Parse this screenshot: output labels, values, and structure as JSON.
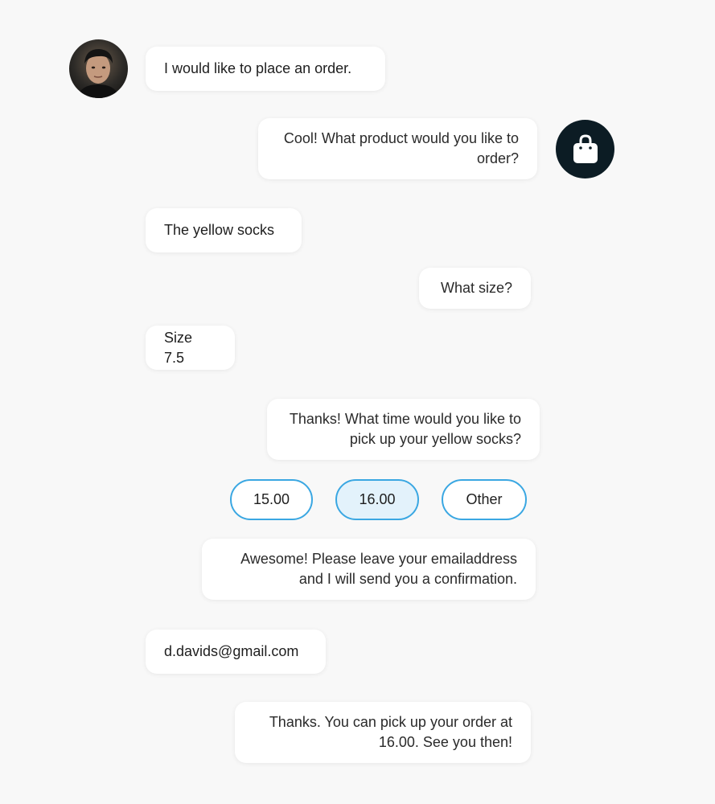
{
  "conversation": {
    "messages": [
      {
        "sender": "user",
        "text": "I would like to place an order."
      },
      {
        "sender": "bot",
        "text": "Cool! What product would you like to order?"
      },
      {
        "sender": "user",
        "text": "The yellow socks"
      },
      {
        "sender": "bot",
        "text": "What size?"
      },
      {
        "sender": "user",
        "text": "Size 7.5"
      },
      {
        "sender": "bot",
        "text": "Thanks! What time would you like to pick up your yellow socks?"
      },
      {
        "sender": "bot",
        "text": "Awesome! Please leave your emailaddress and I will send you a confirmation."
      },
      {
        "sender": "user",
        "text": "d.davids@gmail.com"
      },
      {
        "sender": "bot",
        "text": "Thanks. You can pick up your order at 16.00. See you then!"
      }
    ],
    "time_options": [
      {
        "label": "15.00",
        "selected": false
      },
      {
        "label": "16.00",
        "selected": true
      },
      {
        "label": "Other",
        "selected": false
      }
    ]
  },
  "icons": {
    "bot_avatar": "shopping-bag-icon"
  },
  "colors": {
    "accent": "#3aa7e2",
    "selected_chip_bg": "#e3f2fb",
    "bot_avatar_bg": "#0c1c24"
  }
}
